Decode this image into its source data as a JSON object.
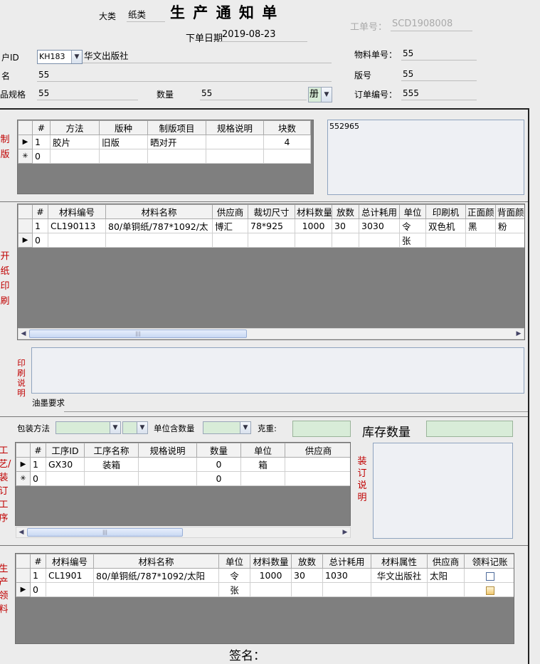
{
  "header": {
    "category_label": "大类",
    "category_value": "纸类",
    "title": "生 产 通 知 单",
    "date_label": "下单日期",
    "date_value": "2019-08-23",
    "job_no_label": "工单号：",
    "job_no_value": "SCD1908008"
  },
  "info": {
    "customer_id_label": "户ID",
    "customer_id_value": "KH183",
    "customer_name": "华文出版社",
    "name_label": "名",
    "name_value": "55",
    "spec_label": "品规格",
    "spec_value": "55",
    "qty_label": "数量",
    "qty_value": "55",
    "unit_value": "册",
    "material_no_label": "物料单号：",
    "material_no_value": "55",
    "edition_label": "版号",
    "edition_value": "55",
    "order_no_label": "订单编号：",
    "order_no_value": "555"
  },
  "plate": {
    "side_label": "制版",
    "columns": [
      "#",
      "方法",
      "版种",
      "制版项目",
      "规格说明",
      "块数"
    ],
    "rows": [
      {
        "sel": "▶",
        "no": "1",
        "method": "胶片",
        "type": "旧版",
        "item": "晒对开",
        "spec": "",
        "count": "4"
      },
      {
        "sel": "✳",
        "no": "0",
        "method": "",
        "type": "",
        "item": "",
        "spec": "",
        "count": ""
      }
    ],
    "memo": "552965"
  },
  "paper": {
    "side_label": "开纸印刷",
    "columns": [
      "#",
      "材料编号",
      "材料名称",
      "供应商",
      "裁切尺寸",
      "材料数量",
      "放数",
      "总计耗用",
      "单位",
      "印刷机",
      "正面颜",
      "背面颜"
    ],
    "rows": [
      {
        "sel": "",
        "no": "1",
        "code": "CL190113",
        "name": "80/单铜纸/787*1092/太",
        "supplier": "博汇",
        "cut": "78*925",
        "qty": "1000",
        "put": "30",
        "total": "3030",
        "unit": "令",
        "press": "双色机",
        "front": "黑",
        "back": "粉"
      },
      {
        "sel": "▶",
        "no": "0",
        "code": "",
        "name": "",
        "supplier": "",
        "cut": "",
        "qty": "",
        "put": "",
        "total": "",
        "unit": "张",
        "press": "",
        "front": "",
        "back": ""
      }
    ]
  },
  "print_note": {
    "label": "印刷说明",
    "ink_label": "油墨要求"
  },
  "binding": {
    "pack_label": "包装方法",
    "unit_qty_label": "单位含数量",
    "weight_label": "克重:",
    "stock_label": "库存数量",
    "side_label": "工艺/装订工序",
    "note_label": "装订说明",
    "columns": [
      "#",
      "工序ID",
      "工序名称",
      "规格说明",
      "数量",
      "单位",
      "供应商"
    ],
    "rows": [
      {
        "sel": "▶",
        "no": "1",
        "id": "GX30",
        "name": "装箱",
        "spec": "",
        "qty": "0",
        "unit": "箱",
        "supplier": ""
      },
      {
        "sel": "✳",
        "no": "0",
        "id": "",
        "name": "",
        "spec": "",
        "qty": "0",
        "unit": "",
        "supplier": ""
      }
    ]
  },
  "material": {
    "side_label": "生产领料",
    "columns": [
      "#",
      "材料编号",
      "材料名称",
      "单位",
      "材料数量",
      "放数",
      "总计耗用",
      "材料属性",
      "供应商",
      "领料记账"
    ],
    "rows": [
      {
        "sel": "",
        "no": "1",
        "code": "CL1901",
        "name": "80/单铜纸/787*1092/太阳",
        "unit": "令",
        "qty": "1000",
        "put": "30",
        "total": "1030",
        "attr": "华文出版社",
        "supplier": "太阳",
        "checked": "false"
      },
      {
        "sel": "▶",
        "no": "0",
        "code": "",
        "name": "",
        "unit": "张",
        "qty": "",
        "put": "",
        "total": "",
        "attr": "",
        "supplier": "",
        "checked": "true"
      }
    ]
  },
  "footer": {
    "sign_label": "签名："
  }
}
